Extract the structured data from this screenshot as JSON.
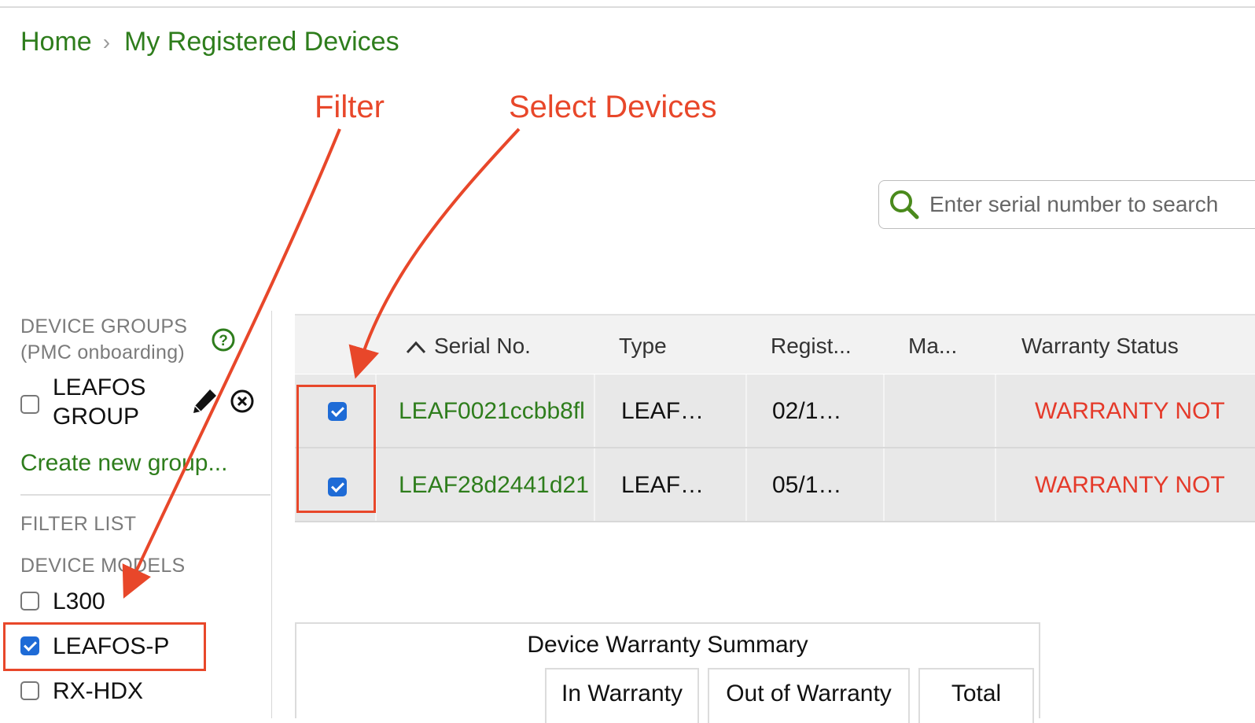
{
  "breadcrumb": {
    "home": "Home",
    "current": "My Registered Devices"
  },
  "annotations": {
    "filter": "Filter",
    "select_devices": "Select Devices",
    "color": "#e8472a"
  },
  "search": {
    "placeholder": "Enter serial number to search",
    "icon": "search-icon"
  },
  "sidebar": {
    "device_groups_title": "DEVICE GROUPS",
    "device_groups_subtitle": "(PMC onboarding)",
    "groups": [
      {
        "name_line1": "LEAFOS",
        "name_line2": "GROUP",
        "checked": false
      }
    ],
    "create_group_link": "Create new group...",
    "filter_list_title": "FILTER LIST",
    "device_models_title": "DEVICE MODELS",
    "models": [
      {
        "label": "L300",
        "checked": false
      },
      {
        "label": "LEAFOS-P",
        "checked": true
      },
      {
        "label": "RX-HDX",
        "checked": false
      }
    ]
  },
  "table": {
    "headers": [
      "Serial No.",
      "Type",
      "Regist...",
      "Ma...",
      "Warranty Status"
    ],
    "sort_column": "Serial No.",
    "rows": [
      {
        "checked": true,
        "serial": "LEAF0021ccbb8fl",
        "type": "LEAF…",
        "registered": "02/1…",
        "manufacturer": "",
        "warranty": "WARRANTY NOT"
      },
      {
        "checked": true,
        "serial": "LEAF28d2441d21",
        "type": "LEAF…",
        "registered": "05/1…",
        "manufacturer": "",
        "warranty": "WARRANTY NOT"
      }
    ]
  },
  "summary": {
    "title": "Device Warranty Summary",
    "columns": [
      "In Warranty",
      "Out of Warranty",
      "Total"
    ]
  },
  "colors": {
    "brand_green": "#2e7d1c",
    "checkbox_blue": "#1e6bd6",
    "warning_red": "#e53a2a"
  }
}
